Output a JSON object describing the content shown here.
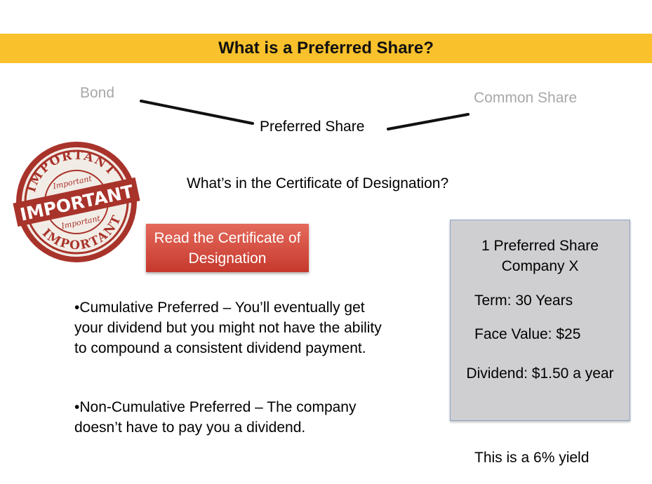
{
  "banner": {
    "title": "What is a Preferred Share?",
    "color": "#F9C12B"
  },
  "diagram": {
    "bond": "Bond",
    "common": "Common Share",
    "preferred": "Preferred Share"
  },
  "question": "What’s in the Certificate of Designation?",
  "stamp": {
    "icon": "important-stamp-icon",
    "main": "IMPORTANT",
    "arc": "IMPORTANT",
    "script": "Important",
    "color": "#9e2a22"
  },
  "button": {
    "label": "Read the Certificate of Designation"
  },
  "bullets": [
    "•Cumulative Preferred – You’ll eventually get your dividend but you might not have the ability to compound a consistent dividend payment.",
    "•Non-Cumulative Preferred – The company doesn’t have to pay you a dividend."
  ],
  "certificate": {
    "title": "1 Preferred Share Company X",
    "term": "Term: 30 Years",
    "face": "Face Value: $25",
    "dividend": "Dividend: $1.50 a year"
  },
  "yield": "This is a 6% yield"
}
